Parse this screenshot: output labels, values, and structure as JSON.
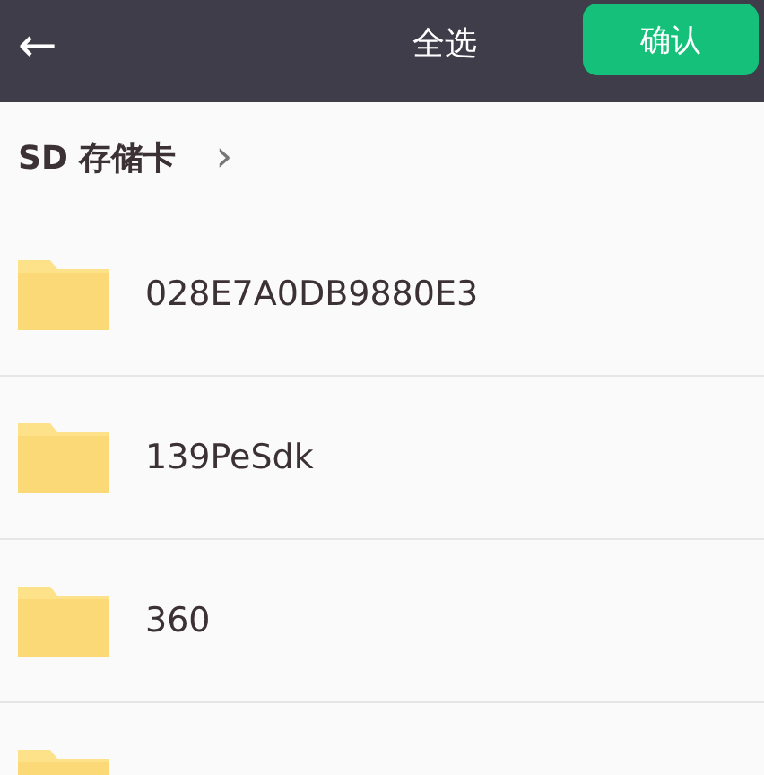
{
  "header": {
    "back": "←",
    "title": "全选",
    "confirm": "确认"
  },
  "breadcrumb": {
    "label": "SD 存储卡",
    "separator": "›"
  },
  "items": [
    {
      "kind": "folder",
      "name": "028E7A0DB9880E3"
    },
    {
      "kind": "folder",
      "name": "139PeSdk"
    },
    {
      "kind": "folder",
      "name": "360"
    },
    {
      "kind": "folder"
    }
  ]
}
